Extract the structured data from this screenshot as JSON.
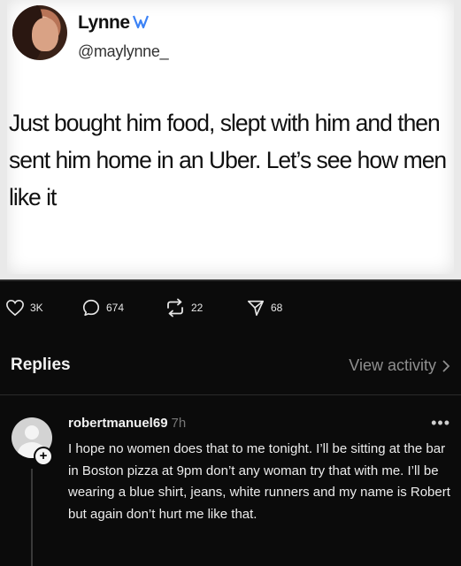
{
  "tweet": {
    "name": "Lynne",
    "handle": "@maylynne_",
    "text": "Just bought him food, slept with him and then sent him home in an Uber. Let’s see how men like it"
  },
  "stats": {
    "likes": "3K",
    "comments": "674",
    "reposts": "22",
    "shares": "68"
  },
  "replies_header": {
    "title": "Replies",
    "view_activity": "View activity"
  },
  "reply": {
    "username": "robertmanuel69",
    "time": "7h",
    "text": "I hope no women does that to me tonight. I’ll be sitting at the bar in Boston pizza at 9pm don’t any woman try that with me. I’ll be wearing a blue shirt, jeans, white runners and my name is Robert but again don’t hurt me like that."
  },
  "colors": {
    "background": "#0b0b0b",
    "verified": "#3b82f6",
    "muted_text": "#8f8f8f"
  },
  "icons": [
    "verified-icon",
    "heart-icon",
    "comment-icon",
    "repost-icon",
    "share-icon",
    "chevron-right-icon",
    "more-icon",
    "plus-icon"
  ]
}
